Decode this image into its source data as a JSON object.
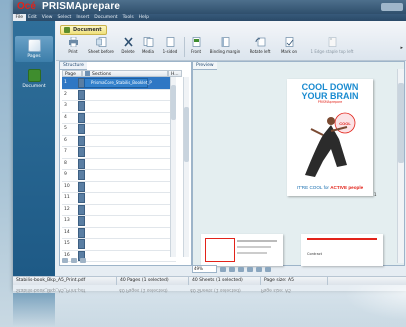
{
  "window": {
    "logo": "Océ",
    "title": "PRISMAprepare"
  },
  "menu": [
    "File",
    "Edit",
    "View",
    "Select",
    "Insert",
    "Document",
    "Tools",
    "Help"
  ],
  "nav": [
    {
      "label": "Pages",
      "icon": "pages-icon",
      "active": true
    },
    {
      "label": "Document",
      "icon": "document-icon",
      "active": false
    }
  ],
  "ribbon": {
    "tab": "Document",
    "tools": [
      {
        "label": "Print",
        "icon": "print-icon"
      },
      {
        "label": "Sheet before",
        "icon": "sheet-before-icon"
      },
      {
        "label": "Delete",
        "icon": "delete-icon"
      },
      {
        "label": "Media",
        "icon": "media-icon"
      },
      {
        "label": "1-sided",
        "icon": "one-sided-icon"
      },
      {
        "label": "Front",
        "icon": "front-icon"
      },
      {
        "label": "Binding margin",
        "icon": "binding-margin-icon"
      },
      {
        "label": "Rotate left",
        "icon": "rotate-left-icon"
      },
      {
        "label": "Mark on",
        "icon": "mark-on-icon"
      },
      {
        "label": "1 Edge staple top left",
        "icon": "staple-icon"
      }
    ]
  },
  "structure": {
    "header": "Structure",
    "columns": [
      "Page",
      "Sections",
      "H..."
    ],
    "file_label": "PrismaCore_Stabilis_Booklet_P",
    "rows": [
      "1",
      "2",
      "3",
      "4",
      "5",
      "6",
      "7",
      "8",
      "9",
      "10",
      "11",
      "12",
      "13",
      "14",
      "15",
      "16"
    ]
  },
  "preview": {
    "header": "Preview",
    "cover": {
      "title_1": "COOL DOWN",
      "title_2": "YOUR BRAIN",
      "subtitle": "PRISMAprepare",
      "footer_1": "IT'RE COOL for ",
      "footer_2": "ACTIVE people"
    },
    "page_number": "1",
    "zoom": "49%",
    "thumb_label": "Contract"
  },
  "status": [
    "Stabilis-book_Bkp_A5_Print.pdf",
    "40 Pages (1 selected)",
    "40 Sheets (1 selected)",
    "Page size: A5"
  ],
  "colors": {
    "brand_red": "#e2231a",
    "title_bar": "#2f4f6c",
    "selection": "#2f77c4",
    "cover_blue": "#1a8bd0"
  }
}
